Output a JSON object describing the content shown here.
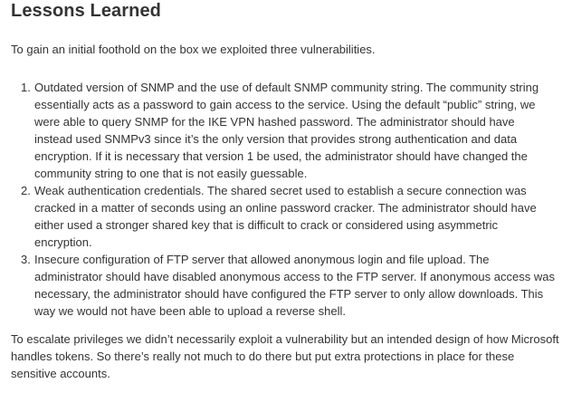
{
  "article": {
    "heading": "Lessons Learned",
    "intro": "To gain an initial foothold on the box we exploited three vulnerabilities.",
    "items": [
      {
        "number": "1.",
        "text": "Outdated version of SNMP and the use of default SNMP community string. The community string essentially acts as a password to gain access to the service. Using the default “public” string, we were able to query SNMP for the IKE VPN hashed password. The administrator should have instead used SNMPv3 since it’s the only version that provides strong authentication and data encryption. If it is necessary that version 1 be used, the administrator should have changed the community string to one that is not easily guessable."
      },
      {
        "number": "2.",
        "text": "Weak authentication credentials. The shared secret used to establish a secure connection was cracked in a matter of seconds using an online password cracker. The administrator should have either used a stronger shared key that is difficult to crack or considered using asymmetric encryption."
      },
      {
        "number": "3.",
        "text": "Insecure configuration of FTP server that allowed anonymous login and file upload. The administrator should have disabled anonymous access to the FTP server. If anonymous access was necessary, the administrator should have configured the FTP server to only allow downloads. This way we would not have been able to upload a reverse shell."
      }
    ],
    "outro": "To escalate privileges we didn’t necessarily exploit a vulnerability but an intended design of how Microsoft handles tokens. So there’s really not much to do there but put extra protections in place for these sensitive accounts."
  }
}
